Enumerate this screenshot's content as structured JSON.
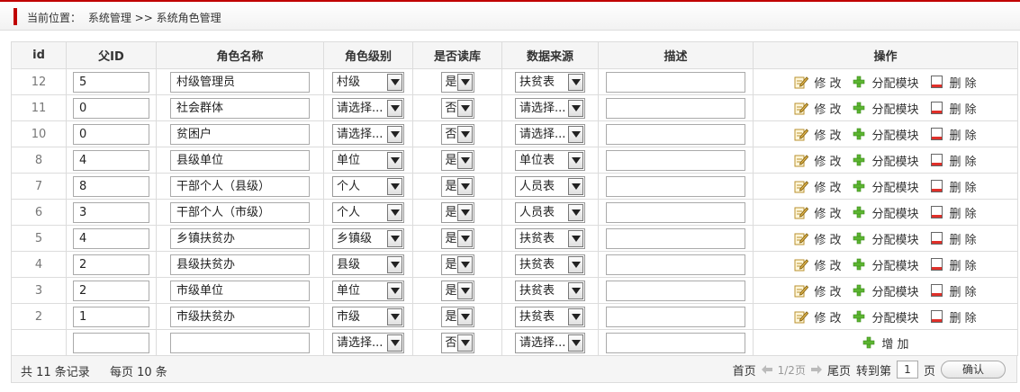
{
  "breadcrumb": {
    "prefix": "当前位置：",
    "path": "系统管理 >> 系统角色管理"
  },
  "columns": [
    "id",
    "父ID",
    "角色名称",
    "角色级别",
    "是否读库",
    "数据来源",
    "描述",
    "操作"
  ],
  "actions": {
    "edit": "修 改",
    "assign": "分配模块",
    "delete": "删 除",
    "add": "增 加"
  },
  "rows": [
    {
      "id": "12",
      "pid": "5",
      "name": "村级管理员",
      "level": "村级",
      "read": "是",
      "src": "扶贫表",
      "desc": ""
    },
    {
      "id": "11",
      "pid": "0",
      "name": "社会群体",
      "level": "请选择...",
      "read": "否",
      "src": "请选择...",
      "desc": ""
    },
    {
      "id": "10",
      "pid": "0",
      "name": "贫困户",
      "level": "请选择...",
      "read": "否",
      "src": "请选择...",
      "desc": ""
    },
    {
      "id": "8",
      "pid": "4",
      "name": "县级单位",
      "level": "单位",
      "read": "是",
      "src": "单位表",
      "desc": ""
    },
    {
      "id": "7",
      "pid": "8",
      "name": "干部个人（县级）",
      "level": "个人",
      "read": "是",
      "src": "人员表",
      "desc": ""
    },
    {
      "id": "6",
      "pid": "3",
      "name": "干部个人（市级）",
      "level": "个人",
      "read": "是",
      "src": "人员表",
      "desc": ""
    },
    {
      "id": "5",
      "pid": "4",
      "name": "乡镇扶贫办",
      "level": "乡镇级",
      "read": "是",
      "src": "扶贫表",
      "desc": ""
    },
    {
      "id": "4",
      "pid": "2",
      "name": "县级扶贫办",
      "level": "县级",
      "read": "是",
      "src": "扶贫表",
      "desc": ""
    },
    {
      "id": "3",
      "pid": "2",
      "name": "市级单位",
      "level": "单位",
      "read": "是",
      "src": "扶贫表",
      "desc": ""
    },
    {
      "id": "2",
      "pid": "1",
      "name": "市级扶贫办",
      "level": "市级",
      "read": "是",
      "src": "扶贫表",
      "desc": ""
    }
  ],
  "new_row": {
    "id": "",
    "pid": "",
    "name": "",
    "level": "请选择...",
    "read": "否",
    "src": "请选择...",
    "desc": ""
  },
  "footer": {
    "total": "共 11 条记录",
    "per_page": "每页 10 条",
    "first": "首页",
    "page_info": "1/2页",
    "last": "尾页",
    "goto": "转到第",
    "page_input": "1",
    "page_unit": "页",
    "confirm": "确认"
  },
  "colors": {
    "accent": "#c00000",
    "header_bg": "#f5f5f5",
    "border": "#dcdcdc"
  }
}
